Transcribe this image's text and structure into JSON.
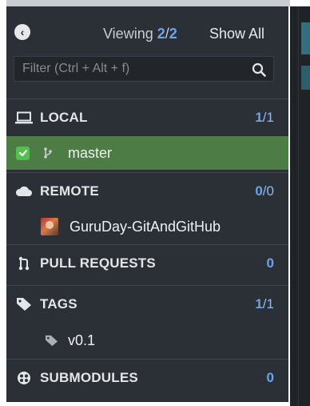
{
  "header": {
    "viewing_label": "Viewing",
    "viewing_count": "2",
    "viewing_sep": "/",
    "viewing_total": "2",
    "show_all_label": "Show All"
  },
  "filter": {
    "placeholder": "Filter (Ctrl + Alt + f)",
    "value": ""
  },
  "sections": {
    "local": {
      "title": "LOCAL",
      "count": "1",
      "sep": "/",
      "total": "1"
    },
    "remote": {
      "title": "REMOTE",
      "count": "0",
      "sep": "/",
      "total": "0"
    },
    "pull_requests": {
      "title": "PULL REQUESTS",
      "count": "0"
    },
    "tags": {
      "title": "TAGS",
      "count": "1",
      "sep": "/",
      "total": "1"
    },
    "submodules": {
      "title": "SUBMODULES",
      "count": "0"
    }
  },
  "local_branches": [
    {
      "name": "master",
      "checked": true
    }
  ],
  "remotes": [
    {
      "name": "GuruDay-GitAndGitHub"
    }
  ],
  "tags": [
    {
      "name": "v0.1"
    }
  ],
  "colors": {
    "panel_bg": "#2b3036",
    "selected_row": "#4d7c45",
    "accent_blue": "#6aa4ea",
    "checkbox_green": "#52c04f"
  }
}
